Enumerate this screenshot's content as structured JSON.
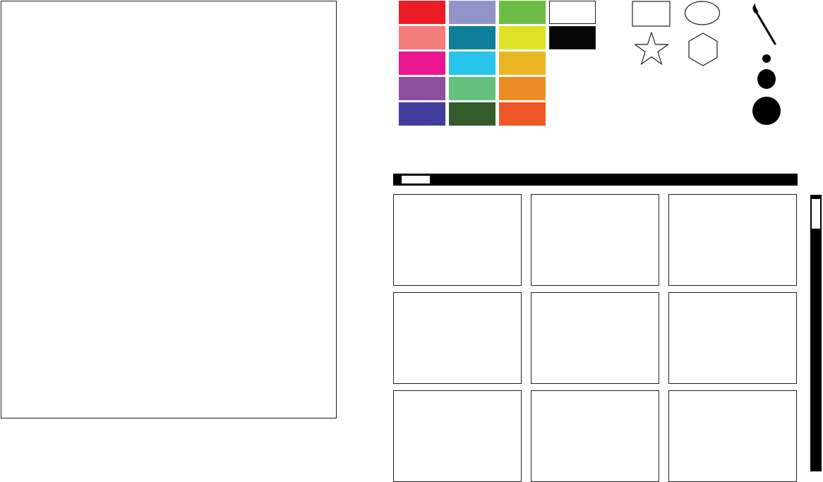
{
  "palette": {
    "colors": [
      "#ed1c24",
      "#9194c9",
      "#6bbd45",
      "#ffffff",
      "#f47d7c",
      "#0e7f9a",
      "#e0e227",
      "#060606",
      "#eb1590",
      "#28c4ec",
      "#eab624",
      "#8f4f9f",
      "#63c07f",
      "#ec8b24",
      "#413d9e",
      "#355c2b",
      "#ee5626"
    ]
  },
  "tools": {
    "shapes": [
      "rectangle-icon",
      "ellipse-icon",
      "star-icon",
      "hexagon-icon"
    ],
    "brush": "paintbrush-icon",
    "brush_sizes": [
      "small",
      "medium",
      "large"
    ]
  },
  "gallery": {
    "thumbnail_count": 9
  }
}
